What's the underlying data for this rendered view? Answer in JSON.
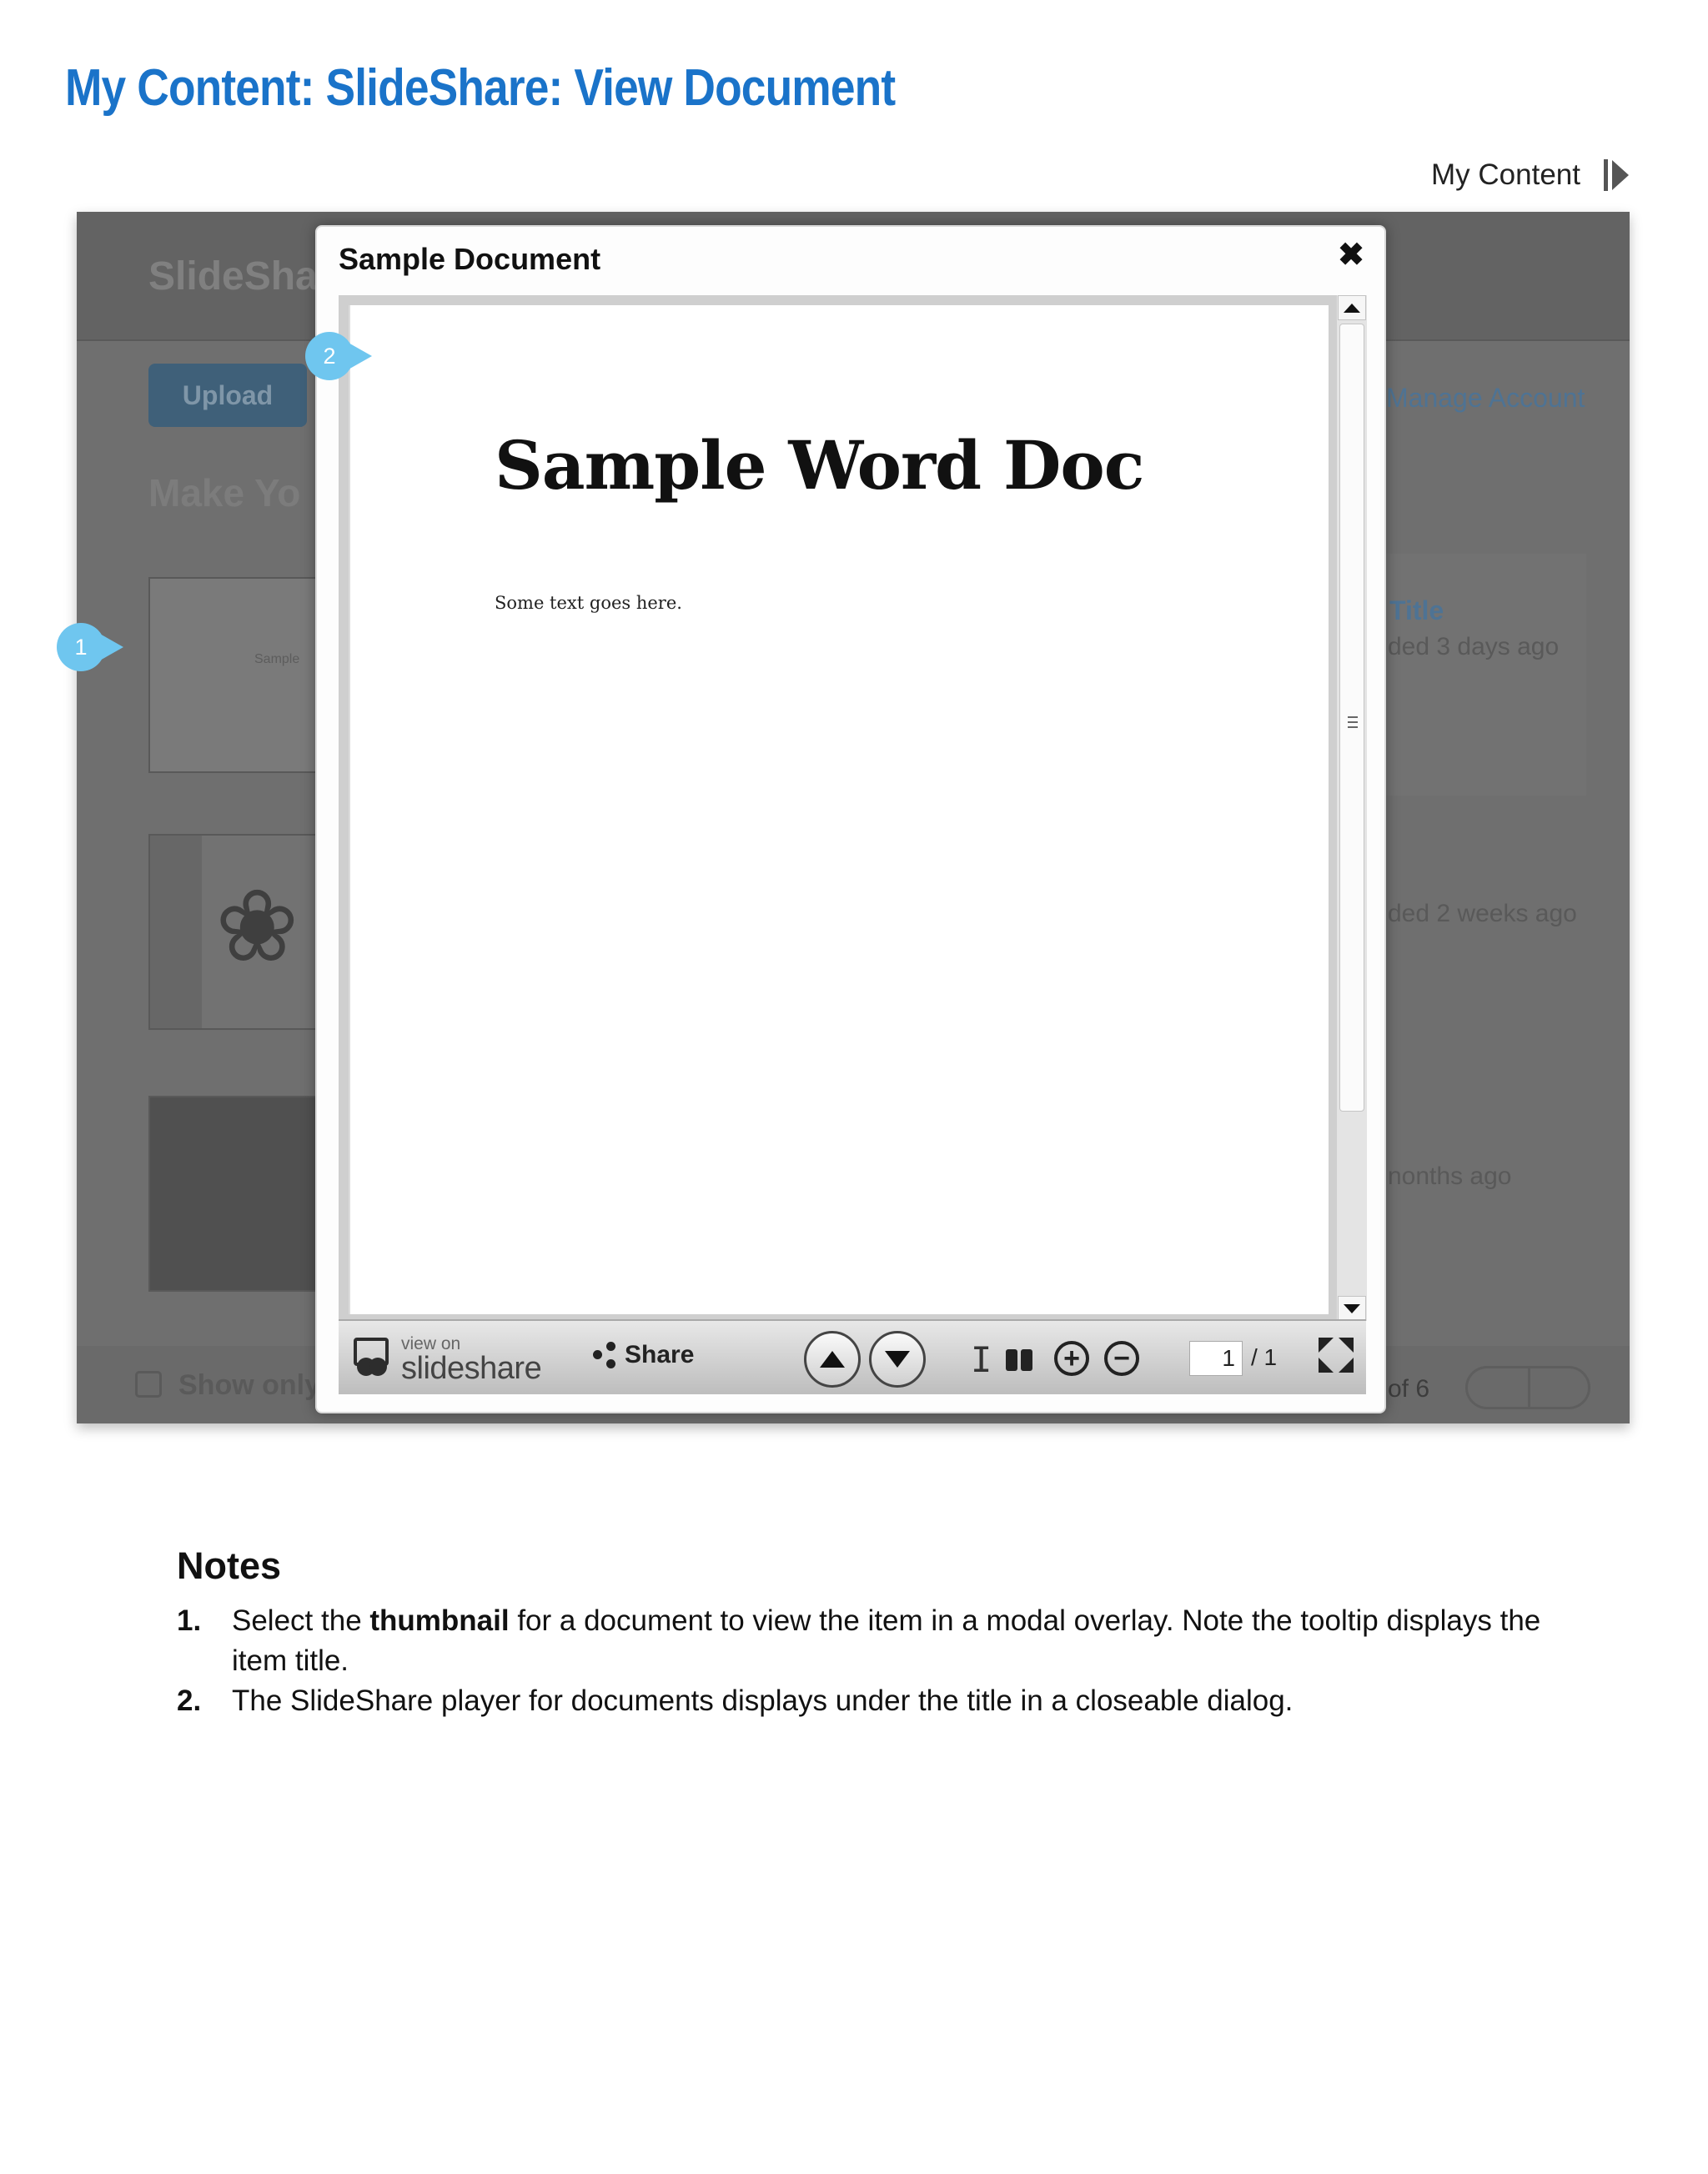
{
  "doc": {
    "title": "My Content: SlideShare: View Document",
    "breadcrumb": "My Content"
  },
  "background": {
    "brand": "SlideSha",
    "upload_label": "Upload",
    "manage_account": "Manage Account",
    "heading": "Make Yo",
    "thumb1_text": "Sample",
    "item_title": "Title",
    "item_meta": [
      "ded 3 days ago",
      "ded 2 weeks ago",
      "nonths ago"
    ],
    "show_only": "Show only",
    "pager_text": "of 6"
  },
  "modal": {
    "title": "Sample Document",
    "close_glyph": "✖",
    "document": {
      "heading": "Sample Word Doc",
      "body": "Some text goes here."
    },
    "toolbar": {
      "view_on": "view on",
      "brand": "slideshare",
      "share_label": "Share",
      "page_current": "1",
      "page_total": "/ 1"
    }
  },
  "callouts": [
    "1",
    "2"
  ],
  "notes": {
    "heading": "Notes",
    "items": [
      {
        "num": "1.",
        "text_before": "Select the ",
        "bold": "thumbnail",
        "text_after": " for a document to view the item in a modal overlay. Note the tooltip displays the item title."
      },
      {
        "num": "2.",
        "text": "The SlideShare player for documents displays under the title in a closeable dialog."
      }
    ]
  },
  "colors": {
    "title_blue": "#1a73c9",
    "callout": "#6fc6ef",
    "overlay": "#6f6f6f"
  },
  "icons": [
    "next-arrow-icon",
    "close-icon",
    "slideshare-logo-icon",
    "share-icon",
    "previous-page-icon",
    "next-page-icon",
    "text-select-icon",
    "find-icon",
    "zoom-in-icon",
    "zoom-out-icon",
    "fullscreen-icon"
  ]
}
